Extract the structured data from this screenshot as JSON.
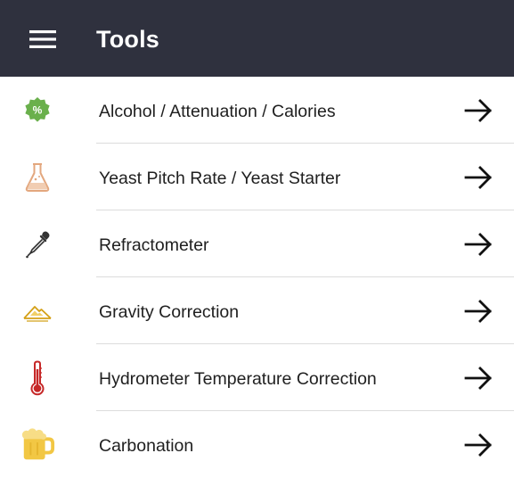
{
  "appbar": {
    "title": "Tools",
    "menu_icon": "hamburger-menu-icon",
    "background": "#2f313e"
  },
  "tools": [
    {
      "label": "Alcohol / Attenuation / Calories",
      "icon": "percent-badge-icon",
      "icon_color": "#6ab04c"
    },
    {
      "label": "Yeast Pitch Rate / Yeast Starter",
      "icon": "flask-icon",
      "icon_color": "#e3a77e"
    },
    {
      "label": "Refractometer",
      "icon": "dropper-icon",
      "icon_color": "#333333"
    },
    {
      "label": "Gravity Correction",
      "icon": "hill-icon",
      "icon_color": "#d4a017"
    },
    {
      "label": "Hydrometer Temperature Correction",
      "icon": "thermometer-icon",
      "icon_color": "#c62828"
    },
    {
      "label": "Carbonation",
      "icon": "beer-mug-icon",
      "icon_color": "#f2c744"
    }
  ],
  "row_action_icon": "arrow-right-icon"
}
